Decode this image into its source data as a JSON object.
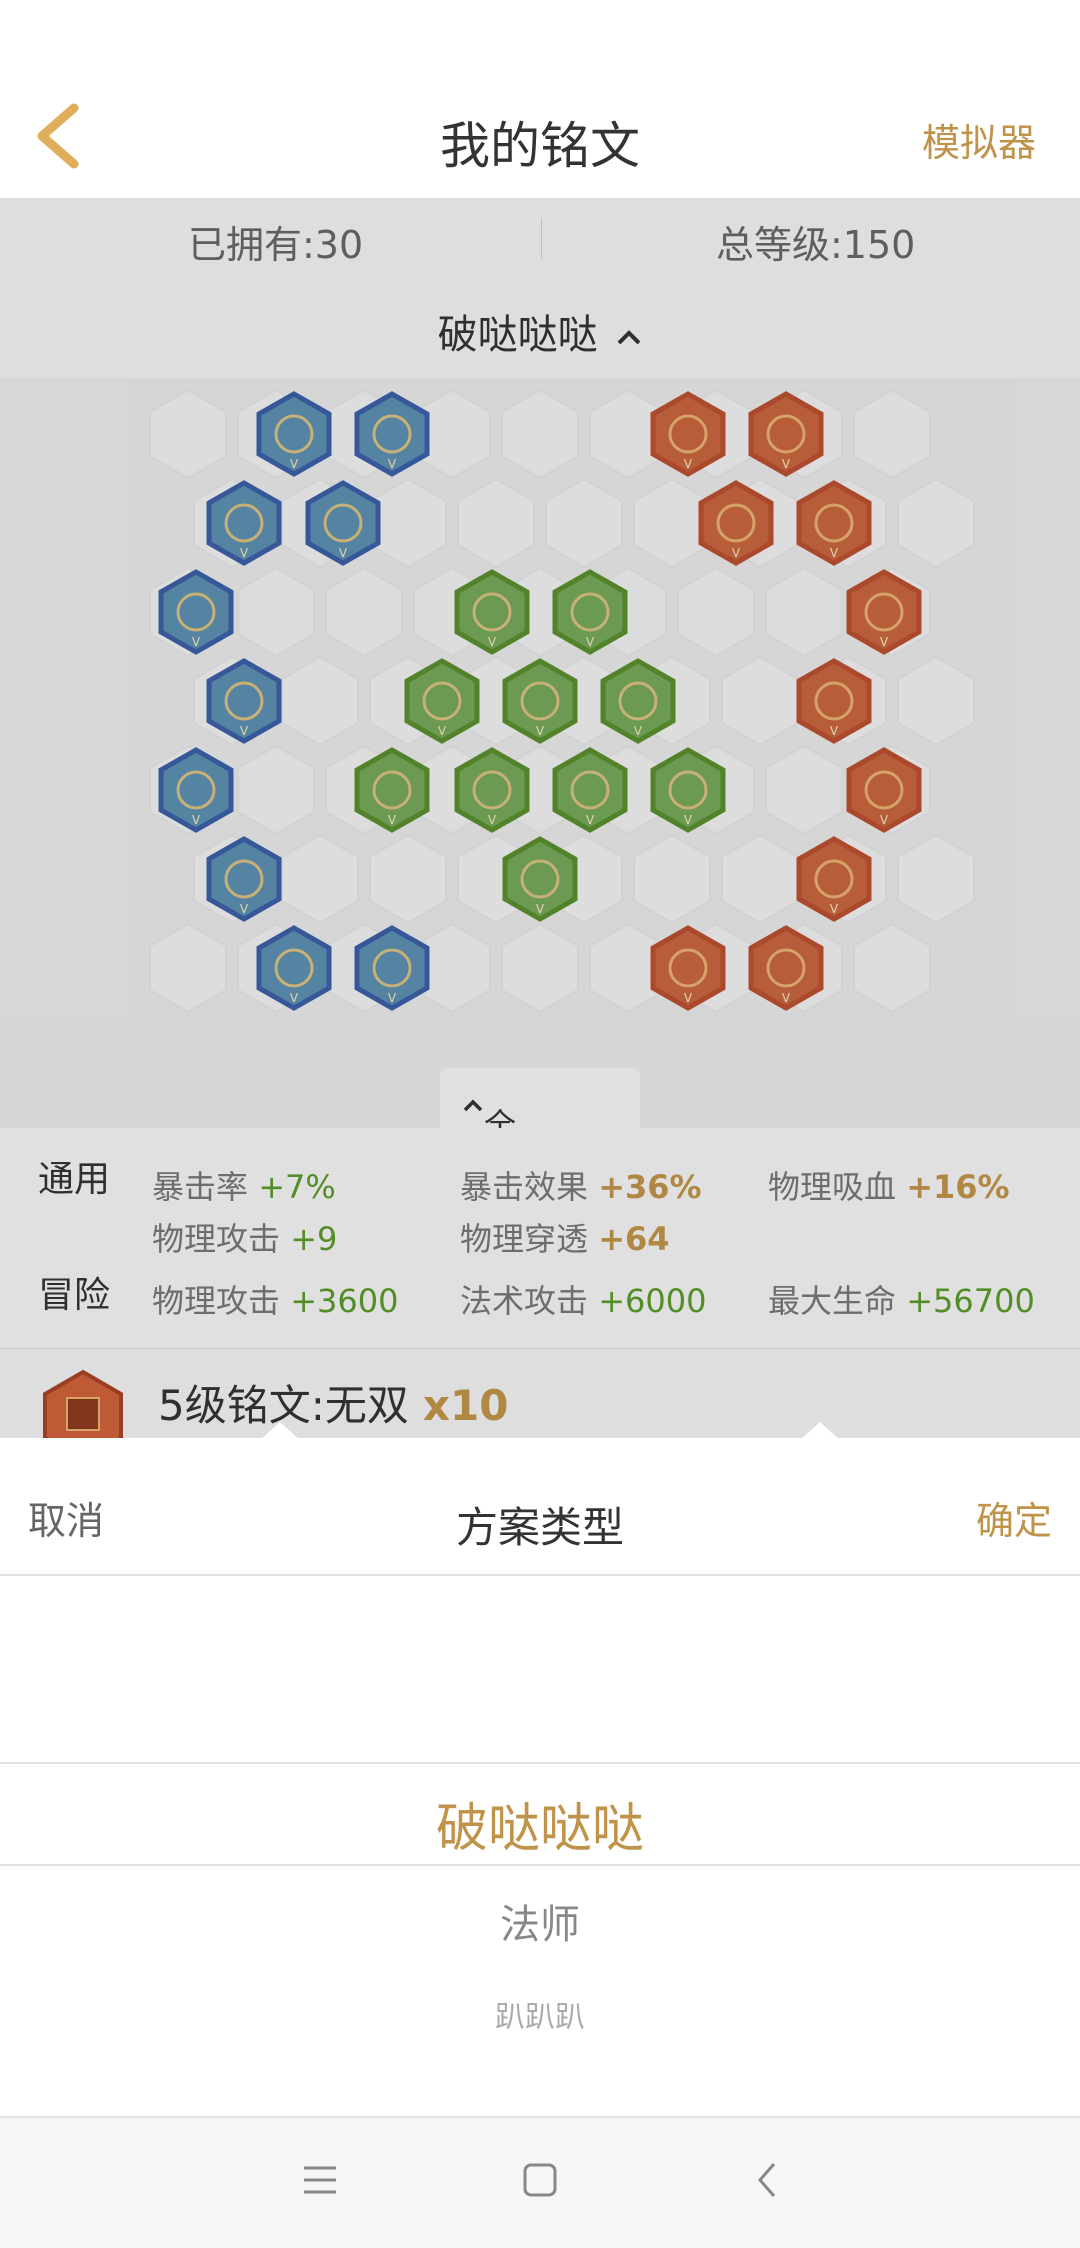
{
  "header": {
    "title": "我的铭文",
    "simulator_label": "模拟器"
  },
  "stats": {
    "owned": "已拥有:30",
    "total_level": "总等级:150"
  },
  "plan": {
    "name": "破哒哒哒"
  },
  "attributes": {
    "tab_label": "全部属性",
    "general": {
      "label": "通用",
      "items": [
        {
          "name": "暴击率",
          "value": "+7%"
        },
        {
          "name": "暴击效果",
          "value": "+36%"
        },
        {
          "name": "物理吸血",
          "value": "+16%"
        },
        {
          "name": "物理攻击",
          "value": "+9"
        },
        {
          "name": "物理穿透",
          "value": "+64"
        }
      ]
    },
    "adventure": {
      "label": "冒险",
      "items": [
        {
          "name": "物理攻击",
          "value": "+3600"
        },
        {
          "name": "法术攻击",
          "value": "+6000"
        },
        {
          "name": "最大生命",
          "value": "+56700"
        }
      ]
    }
  },
  "inscription_entry": {
    "title": "5级铭文:无双",
    "count": "x10"
  },
  "sheet": {
    "cancel_label": "取消",
    "title": "方案类型",
    "confirm_label": "确定",
    "options": [
      "破哒哒哒",
      "法师",
      "趴趴趴"
    ],
    "selected_index": 0
  },
  "colors": {
    "accent": "#c0934a",
    "positive": "#5a9a2a",
    "blue_gem": "#3b5fa8",
    "green_gem": "#5a8f2e",
    "red_gem": "#b9502f"
  },
  "nav": {
    "icons": [
      "menu-icon",
      "home-square-icon",
      "back-chevron-icon"
    ]
  }
}
